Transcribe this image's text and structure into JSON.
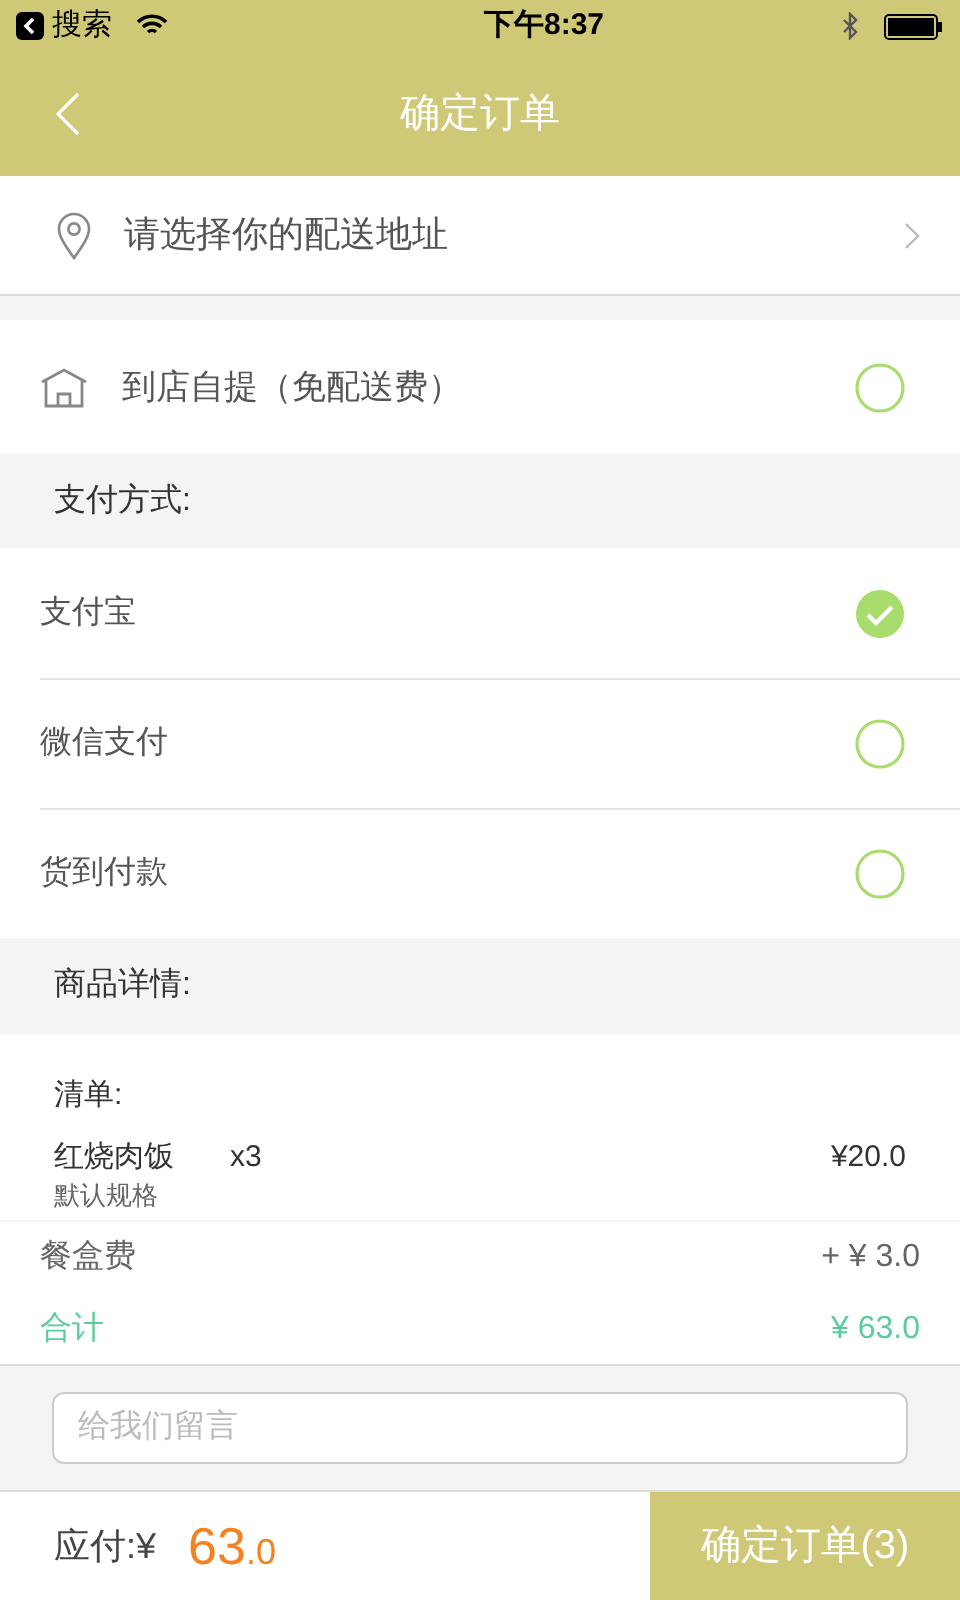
{
  "status_bar": {
    "back_app": "搜索",
    "time": "下午8:37"
  },
  "header": {
    "title": "确定订单"
  },
  "address": {
    "placeholder_text": "请选择你的配送地址"
  },
  "pickup": {
    "label": "到店自提（免配送费）",
    "selected": false
  },
  "payment": {
    "heading": "支付方式:",
    "options": [
      {
        "label": "支付宝",
        "selected": true
      },
      {
        "label": "微信支付",
        "selected": false
      },
      {
        "label": "货到付款",
        "selected": false
      }
    ]
  },
  "goods": {
    "heading": "商品详情:",
    "list_label": "清单:",
    "items": [
      {
        "name": "红烧肉饭",
        "quantity": "x3",
        "price": "¥20.0",
        "spec": "默认规格"
      }
    ],
    "box_fee": {
      "label": "餐盒费",
      "value": "+ ¥ 3.0"
    },
    "total": {
      "label": "合计",
      "value": "¥ 63.0"
    }
  },
  "message": {
    "placeholder": "给我们留言"
  },
  "footer": {
    "label": "应付:¥",
    "amount_integer": "63",
    "amount_decimal": ".0",
    "button": "确定订单(3)"
  }
}
